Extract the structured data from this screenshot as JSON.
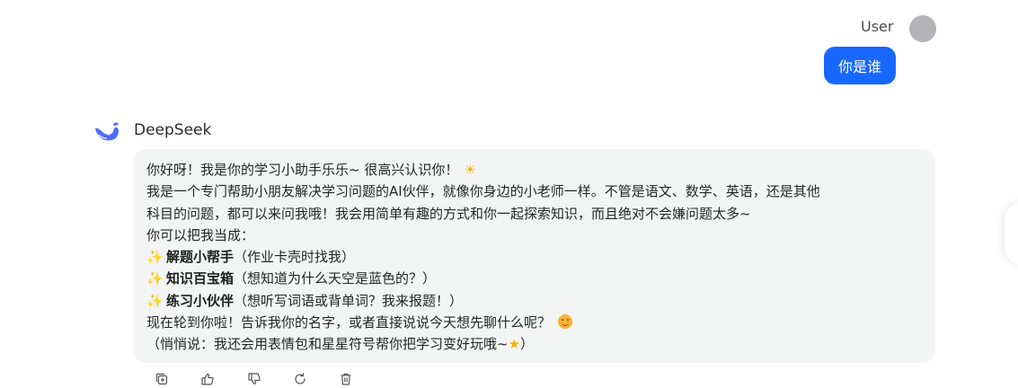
{
  "user": {
    "name": "User",
    "message": "你是谁"
  },
  "assistant": {
    "name": "DeepSeek",
    "lines": {
      "greeting": "你好呀！我是你的学习小助手乐乐~ 很高兴认识你！",
      "intro1": "我是一个专门帮助小朋友解决学习问题的AI伙伴，就像你身边的小老师一样。不管是语文、数学、英语，还是其他",
      "intro2": "科目的问题，都可以来问我哦！我会用简单有趣的方式和你一起探索知识，而且绝对不会嫌问题太多~",
      "treat_as": "你可以把我当成：",
      "item1_bold": "解题小帮手",
      "item1_rest": "（作业卡壳时找我）",
      "item2_bold": "知识百宝箱",
      "item2_rest": "（想知道为什么天空是蓝色的？）",
      "item3_bold": "练习小伙伴",
      "item3_rest": "（想听写词语或背单词？我来报题！）",
      "your_turn": "现在轮到你啦！告诉我你的名字，或者直接说说今天想先聊什么呢？",
      "whisper_start": "（悄悄说：我还会用表情包和星星符号帮你把学习变好玩哦~",
      "whisper_end": "）"
    },
    "emoji": {
      "sun": "☀",
      "sparkle": "✨",
      "star": "★"
    }
  },
  "actions": [
    "copy-icon",
    "thumbs-up-icon",
    "thumbs-down-icon",
    "regenerate-icon",
    "delete-icon"
  ],
  "colors": {
    "user_bubble": "#1868ff",
    "assistant_bubble": "#f3f4f4",
    "logo": "#4d6bfe",
    "avatar": "#b4b4b8"
  }
}
